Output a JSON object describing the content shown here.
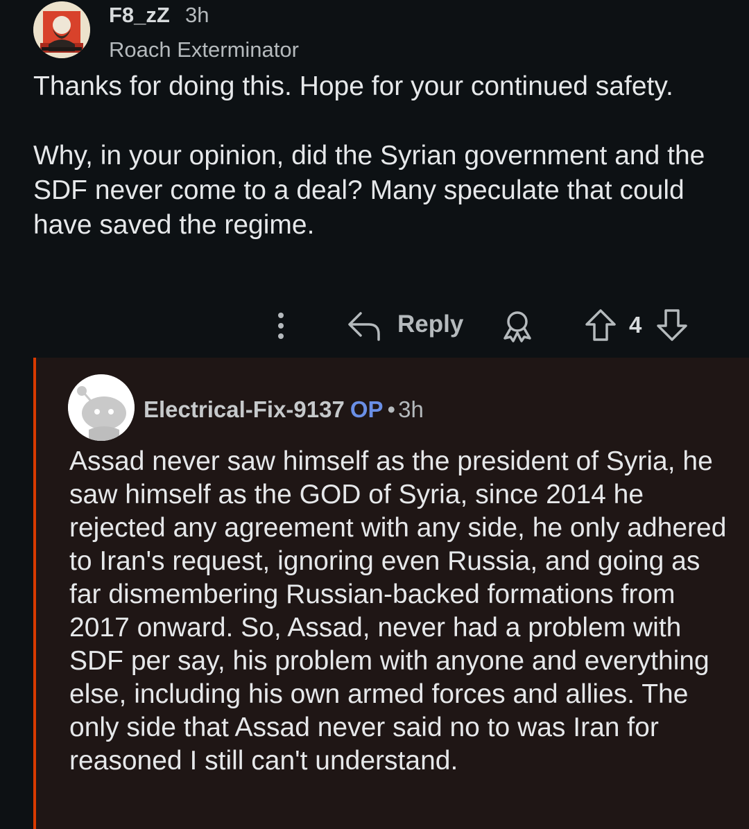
{
  "parent_comment": {
    "username": "F8_zZ",
    "time": "3h",
    "flair": "Roach Exterminator",
    "avatar_icon": "lenin-portrait-avatar",
    "body": [
      "Thanks for doing this. Hope for your continued safety.",
      "Why, in your opinion, did the Syrian government and the SDF never come to a deal? Many speculate that could have saved the regime."
    ]
  },
  "actions": {
    "more_icon": "more-vertical-icon",
    "reply_icon": "reply-arrow-icon",
    "reply_label": "Reply",
    "award_icon": "award-icon",
    "upvote_icon": "upvote-arrow-icon",
    "vote_count": "4",
    "downvote_icon": "downvote-arrow-icon"
  },
  "reply_comment": {
    "username": "Electrical-Fix-9137",
    "op_badge": "OP",
    "separator": "•",
    "time": "3h",
    "avatar_icon": "default-snoo-avatar",
    "body": "Assad never saw himself as the president of Syria, he saw himself as the GOD of Syria, since 2014 he rejected any agreement with any side, he only adhered to Iran's request, ignoring even Russia, and going as far dismembering Russian-backed formations from 2017 onward. So, Assad, never had a problem with SDF per say, his problem with anyone and everything else, including his own armed forces and allies. The only side that Assad never said no to was Iran for reasoned I still can't understand."
  },
  "colors": {
    "background": "#0d1114",
    "reply_background": "#1f1615",
    "thread_line": "#d93a00",
    "op_badge": "#6a8fe6",
    "text": "#e6e8ea",
    "meta_text": "#b5babd"
  }
}
